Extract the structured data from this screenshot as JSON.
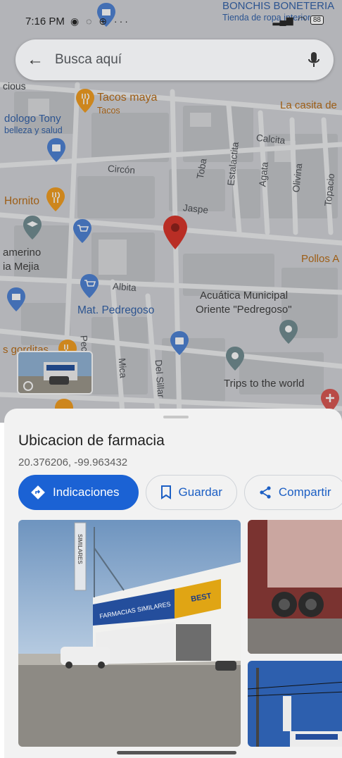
{
  "status_bar": {
    "time": "7:16 PM",
    "battery": "88"
  },
  "search": {
    "placeholder": "Busca aquí"
  },
  "map": {
    "places": {
      "bonchis": "BONCHIS BONETERIA",
      "bonchis_sub": "Tienda de ropa interior",
      "tacos_maya": "Tacos maya",
      "tacos_maya_sub": "Tacos",
      "la_casita": "La casita de",
      "podologo": "dologo Tony",
      "podologo_sub": "belleza y salud",
      "hornito": "Hornito",
      "camerino": "amerino",
      "mejia": "ia Mejia",
      "mat_pedregoso": "Mat. Pedregoso",
      "acuatica_1": "Acuática Municipal",
      "acuatica_2": "Oriente \"Pedregoso\"",
      "pollos": "Pollos A",
      "gorditas": "s gorditas",
      "trips": "Trips to the world",
      "cious": "cious"
    },
    "streets": {
      "calcita": "Calcita",
      "circon": "Circón",
      "toba": "Toba",
      "estalactita": "Estalactita",
      "agata": "Agata",
      "olivina": "Olivina",
      "topacio": "Topacio",
      "jaspe": "Jaspe",
      "albita": "Albita",
      "mica": "Mica",
      "del_sillar": "Del Sillar",
      "pedregoso": "Pec"
    }
  },
  "place": {
    "title": "Ubicacion de farmacia",
    "coords": "20.376206, -99.963432"
  },
  "actions": {
    "directions": "Indicaciones",
    "save": "Guardar",
    "share": "Compartir"
  },
  "photo_text": {
    "pharmacy_sign": "FARMACIAS SIMILARES",
    "similares": "SIMILARES",
    "best": "BEST"
  },
  "colors": {
    "primary_blue": "#1b62d4",
    "pin_red": "#d93025",
    "food_orange": "#f29b1c",
    "shop_blue": "#4a7fd4",
    "poi_gray": "#6e8a8f"
  }
}
